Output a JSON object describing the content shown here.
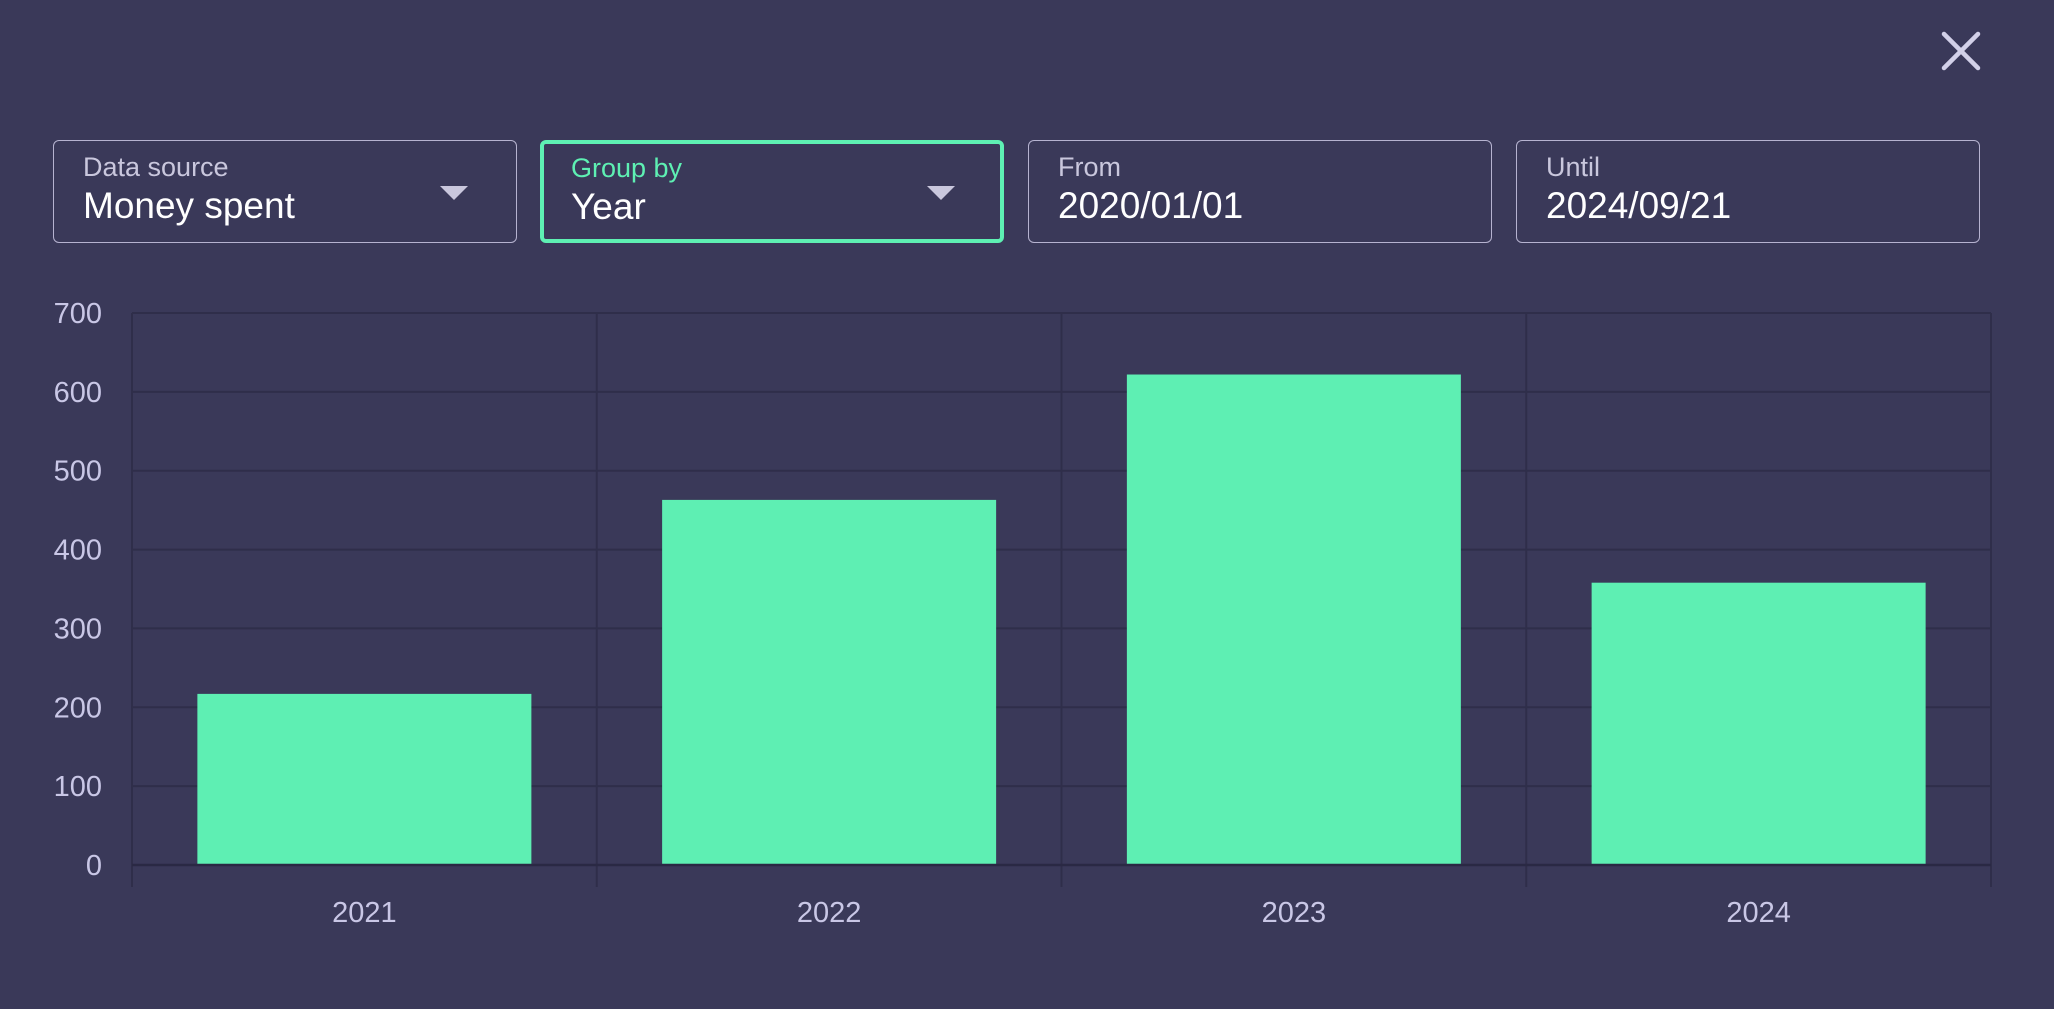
{
  "colors": {
    "background": "#3a3959",
    "accent": "#5ef0b3",
    "bar": "#5eefb3",
    "gridline": "#2f2e4a",
    "axis_text": "#c9c7e6"
  },
  "close_icon": "close-icon",
  "filters": {
    "data_source": {
      "label": "Data source",
      "value": "Money spent",
      "icon": "chevron-down-icon"
    },
    "group_by": {
      "label": "Group by",
      "value": "Year",
      "icon": "chevron-down-icon"
    },
    "from": {
      "label": "From",
      "value": "2020/01/01"
    },
    "until": {
      "label": "Until",
      "value": "2024/09/21"
    }
  },
  "chart_data": {
    "type": "bar",
    "categories": [
      "2021",
      "2022",
      "2023",
      "2024"
    ],
    "values": [
      217,
      463,
      622,
      358
    ],
    "yticks": [
      0,
      100,
      200,
      300,
      400,
      500,
      600,
      700
    ],
    "ylim": [
      0,
      700
    ],
    "grid": true,
    "title": "",
    "xlabel": "",
    "ylabel": ""
  }
}
